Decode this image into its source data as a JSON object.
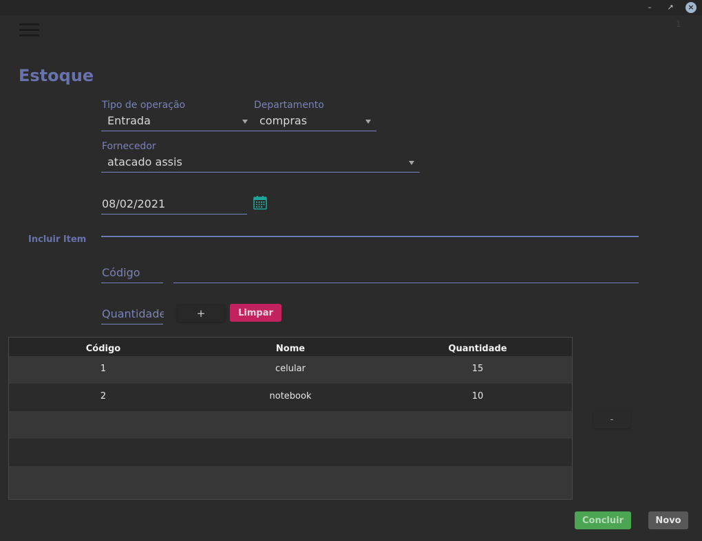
{
  "window": {
    "minimize_glyph": "–",
    "maximize_glyph": "↗",
    "close_glyph": "×",
    "corner_text": "1"
  },
  "header": {
    "menu_icon": "hamburger-menu-icon",
    "title": "Estoque"
  },
  "form": {
    "tipo_operacao": {
      "label": "Tipo de operação",
      "value": "Entrada"
    },
    "departamento": {
      "label": "Departamento",
      "value": "compras"
    },
    "fornecedor": {
      "label": "Fornecedor",
      "value": "atacado assis"
    },
    "data": {
      "value": "08/02/2021",
      "icon": "calendar-icon"
    }
  },
  "incluir_item": {
    "section_label": "Incluir Item",
    "codigo_placeholder": "Código",
    "nome_value": "",
    "quantidade_placeholder": "Quantidade",
    "add_label": "+",
    "limpar_label": "Limpar"
  },
  "table": {
    "headers": [
      "Código",
      "Nome",
      "Quantidade"
    ],
    "rows": [
      {
        "codigo": "1",
        "nome": "celular",
        "quantidade": "15"
      },
      {
        "codigo": "2",
        "nome": "notebook",
        "quantidade": "10"
      }
    ]
  },
  "remove_label": "-",
  "footer": {
    "concluir_label": "Concluir",
    "novo_label": "Novo"
  },
  "colors": {
    "accent": "#6872ad",
    "danger": "#c2235f",
    "success": "#4ca553",
    "neutral_button": "#585858",
    "background": "#2b2b2b"
  }
}
